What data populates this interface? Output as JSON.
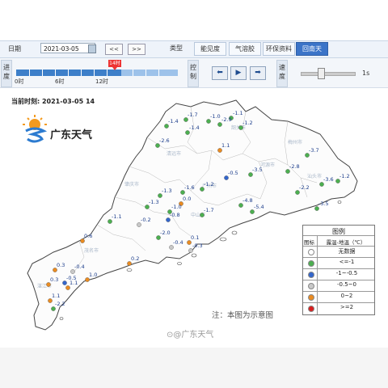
{
  "toolbar": {
    "date_label": "日期",
    "date_value": "2021-03-05",
    "prev_label": "<<",
    "next_label": ">>",
    "type_label": "类型",
    "tabs": [
      "能见度",
      "气溶胶",
      "环保资料",
      "回南天"
    ],
    "active_tab": "回南天"
  },
  "controls": {
    "progress_label": "进度",
    "control_label": "控制",
    "speed_label": "速度",
    "marker": "14时",
    "ticks": [
      "0时",
      "6时",
      "12时"
    ],
    "progress_fraction": 0.58,
    "speed_value": "1s",
    "speed_fraction": 0.3,
    "buttons": [
      "prev",
      "play",
      "next"
    ]
  },
  "map": {
    "time_label": "当前时刻: 2021-03-05 14",
    "logo_text": "广东天气",
    "note": "注：本图为示意图",
    "watermark": "@广东天气",
    "stations": [
      "-1.7",
      "-1.0",
      "-1.1",
      "-1.4",
      "-2.9",
      "-1.2",
      "-1.4",
      "-2.6",
      "-3.7",
      "1.1",
      "-2.8",
      "-0.5",
      "-3.5",
      "-1.3",
      "-1.6",
      "-1.2",
      "0.0",
      "-3.6",
      "-1.2",
      "-1.3",
      "-1.0",
      "-4.8",
      "-5.4",
      "-2.2",
      "-3.5",
      "-0.8",
      "-1.7",
      "-1.1",
      "-0.2",
      "0.6",
      "-2.0",
      "0.1",
      "0.3",
      "-0.4",
      "1.0",
      "0.3",
      "-0.5",
      "1.1",
      "1.1",
      "-2.2",
      "-0.4",
      "-0.3",
      "0.2"
    ]
  },
  "legend": {
    "title": "图例",
    "col1": "图标",
    "col2": "露温-地温（℃）",
    "rows": [
      {
        "color": "#ffffff",
        "label": "无数据"
      },
      {
        "color": "#4caf50",
        "label": "<=-1"
      },
      {
        "color": "#3366cc",
        "label": "-1~-0.5"
      },
      {
        "color": "#c8c8c8",
        "label": "-0.5~0"
      },
      {
        "color": "#e98b21",
        "label": "0~2"
      },
      {
        "color": "#d81e1e",
        "label": ">=2"
      }
    ]
  }
}
